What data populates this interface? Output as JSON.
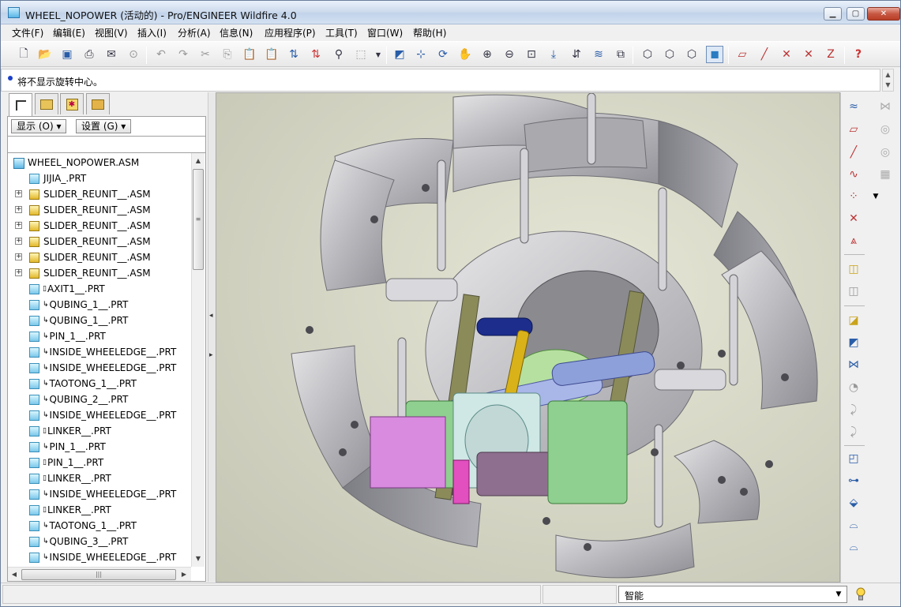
{
  "window": {
    "title": "WHEEL_NOPOWER (活动的) - Pro/ENGINEER Wildfire 4.0"
  },
  "menubar": [
    {
      "label": "文件(F)"
    },
    {
      "label": "编辑(E)"
    },
    {
      "label": "视图(V)"
    },
    {
      "label": "插入(I)"
    },
    {
      "label": "分析(A)"
    },
    {
      "label": "信息(N)"
    },
    {
      "label": "应用程序(P)"
    },
    {
      "label": "工具(T)"
    },
    {
      "label": "窗口(W)"
    },
    {
      "label": "帮助(H)"
    }
  ],
  "message": {
    "text": "将不显示旋转中心。"
  },
  "navigator": {
    "show_button": "显示 (O)",
    "settings_button": "设置 (G)",
    "tree": [
      {
        "label": "WHEEL_NOPOWER.ASM",
        "kind": "root",
        "prefix": ""
      },
      {
        "label": "JIJIA_.PRT",
        "kind": "part",
        "prefix": ""
      },
      {
        "label": "SLIDER_REUNIT__.ASM",
        "kind": "asm",
        "prefix": ""
      },
      {
        "label": "SLIDER_REUNIT__.ASM",
        "kind": "asm",
        "prefix": ""
      },
      {
        "label": "SLIDER_REUNIT__.ASM",
        "kind": "asm",
        "prefix": ""
      },
      {
        "label": "SLIDER_REUNIT__.ASM",
        "kind": "asm",
        "prefix": ""
      },
      {
        "label": "SLIDER_REUNIT__.ASM",
        "kind": "asm",
        "prefix": ""
      },
      {
        "label": "SLIDER_REUNIT__.ASM",
        "kind": "asm",
        "prefix": ""
      },
      {
        "label": "AXIT1__.PRT",
        "kind": "part",
        "prefix": "▯"
      },
      {
        "label": "QUBING_1__.PRT",
        "kind": "part",
        "prefix": "↳"
      },
      {
        "label": "QUBING_1__.PRT",
        "kind": "part",
        "prefix": "↳"
      },
      {
        "label": "PIN_1__.PRT",
        "kind": "part",
        "prefix": "↳"
      },
      {
        "label": "INSIDE_WHEELEDGE__.PRT",
        "kind": "part",
        "prefix": "↳"
      },
      {
        "label": "INSIDE_WHEELEDGE__.PRT",
        "kind": "part",
        "prefix": "↳"
      },
      {
        "label": "TAOTONG_1__.PRT",
        "kind": "part",
        "prefix": "↳"
      },
      {
        "label": "QUBING_2__.PRT",
        "kind": "part",
        "prefix": "↳"
      },
      {
        "label": "INSIDE_WHEELEDGE__.PRT",
        "kind": "part",
        "prefix": "↳"
      },
      {
        "label": "LINKER__.PRT",
        "kind": "part",
        "prefix": "▯"
      },
      {
        "label": "PIN_1__.PRT",
        "kind": "part",
        "prefix": "↳"
      },
      {
        "label": "PIN_1__.PRT",
        "kind": "part",
        "prefix": "▯"
      },
      {
        "label": "LINKER__.PRT",
        "kind": "part",
        "prefix": "▯"
      },
      {
        "label": "INSIDE_WHEELEDGE__.PRT",
        "kind": "part",
        "prefix": "↳"
      },
      {
        "label": "LINKER__.PRT",
        "kind": "part",
        "prefix": "▯"
      },
      {
        "label": "TAOTONG_1__.PRT",
        "kind": "part",
        "prefix": "↳"
      },
      {
        "label": "QUBING_3__.PRT",
        "kind": "part",
        "prefix": "↳"
      },
      {
        "label": "INSIDE_WHEELEDGE__.PRT",
        "kind": "part",
        "prefix": "↳"
      }
    ]
  },
  "statusbar": {
    "filter_value": "智能"
  },
  "colors": {
    "cad_gray": "#b9b9bd",
    "pink_motor": "#d98be0",
    "green_bracket": "#8fcf8f",
    "yellow_shaft": "#d9b21a",
    "navy_link": "#1c2d8c"
  }
}
